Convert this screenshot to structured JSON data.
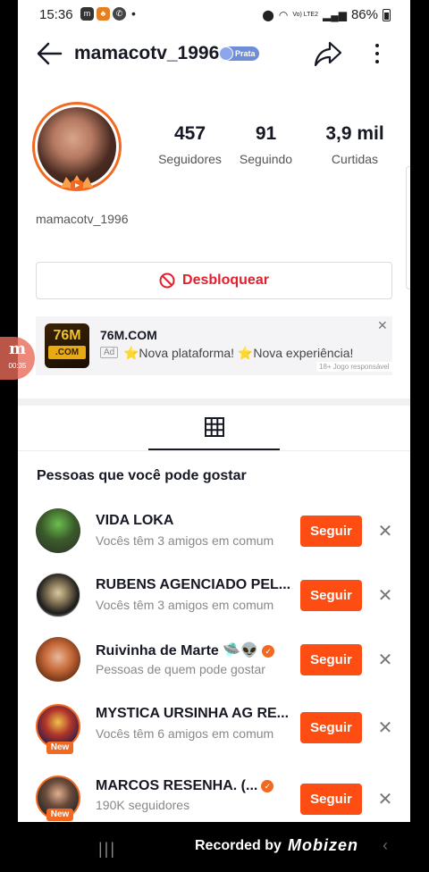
{
  "status_bar": {
    "time": "15:36",
    "app_icons": [
      "m",
      "♣",
      "✆"
    ],
    "dot": "•",
    "network": "Vo) LTE2",
    "battery": "86%"
  },
  "header": {
    "title": "mamacotv_1996",
    "badge": "Prata"
  },
  "profile": {
    "stats": [
      {
        "value": "457",
        "label": "Seguidores"
      },
      {
        "value": "91",
        "label": "Seguindo"
      },
      {
        "value": "3,9 mil",
        "label": "Curtidas"
      }
    ],
    "username": "mamacotv_1996",
    "unblock_label": "Desbloquear"
  },
  "ad": {
    "logo_top": "76M",
    "logo_bottom": ".COM",
    "title": "76M.COM",
    "tag": "Ad",
    "text": "⭐Nova plataforma! ⭐Nova experiência!",
    "disclaimer": "18+ Jogo responsável"
  },
  "recording_bubble": {
    "glyph": "m",
    "time": "00:35"
  },
  "suggestions": {
    "title": "Pessoas que você pode gostar",
    "follow_label": "Seguir",
    "new_label": "New",
    "items": [
      {
        "name": "VIDA LOKA",
        "sub": "Vocês têm 3 amigos em comum",
        "verified": false,
        "is_new": false
      },
      {
        "name": "RUBENS AGENCIADO PEL...",
        "sub": "Vocês têm 3 amigos em comum",
        "verified": false,
        "is_new": false
      },
      {
        "name": "Ruivinha de Marte 🛸👽",
        "sub": "Pessoas de quem pode gostar",
        "verified": true,
        "is_new": false
      },
      {
        "name": "MYSTICA URSINHA AG RE...",
        "sub": "Vocês têm 6 amigos em comum",
        "verified": false,
        "is_new": true
      },
      {
        "name": "MARCOS RESENHA.  (...",
        "sub": "190K seguidores",
        "verified": true,
        "is_new": true
      }
    ]
  },
  "bottom_bar": {
    "recents": "|||",
    "recorded_by": "Recorded by",
    "brand": "Mobizen"
  },
  "colors": {
    "accent": "#fe4d12",
    "danger": "#e0202c",
    "ring": "#f26a21",
    "badge": "#6f8ed8"
  }
}
